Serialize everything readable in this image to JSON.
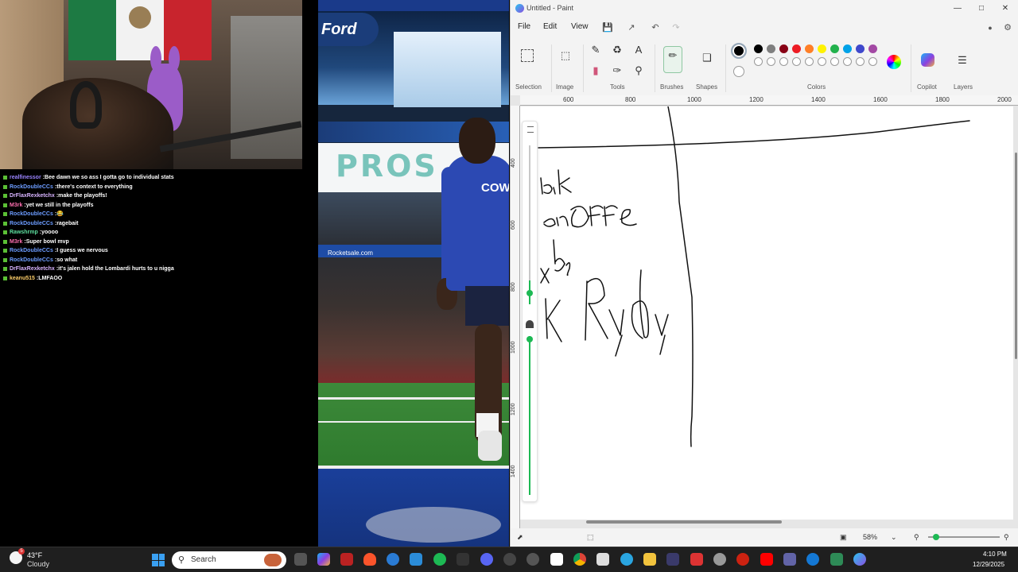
{
  "chat": {
    "messages": [
      {
        "user": "realfinessor",
        "user_color": "#9a84ff",
        "text": "Bee dawn we so ass I gotta go to individual stats"
      },
      {
        "user": "RockDoubleCCs",
        "user_color": "#6c9cff",
        "text": "there's context to everything"
      },
      {
        "user": "DrFlaxRexketchx",
        "user_color": "#d8b4ff",
        "text": "make the playoffs!"
      },
      {
        "user": "M3rk",
        "user_color": "#ff6fb0",
        "text": "yet we still in the playoffs"
      },
      {
        "user": "RockDoubleCCs",
        "user_color": "#6c9cff",
        "text": "😂"
      },
      {
        "user": "RockDoubleCCs",
        "user_color": "#6c9cff",
        "text": "ragebait"
      },
      {
        "user": "Rawshrmp",
        "user_color": "#5ee0a0",
        "text": "yoooo"
      },
      {
        "user": "M3rk",
        "user_color": "#ff6fb0",
        "text": "Super bowl mvp"
      },
      {
        "user": "RockDoubleCCs",
        "user_color": "#6c9cff",
        "text": "I guess we nervous"
      },
      {
        "user": "RockDoubleCCs",
        "user_color": "#6c9cff",
        "text": "so what"
      },
      {
        "user": "DrFlaxRexketchx",
        "user_color": "#d8b4ff",
        "text": "it's jalen hold the Lombardi hurts to u nigga"
      },
      {
        "user": "keanu515",
        "user_color": "#ffcf6a",
        "text": "LMFAOO"
      }
    ]
  },
  "photo": {
    "ford_text": "Ford",
    "pros_text": "PROS",
    "jersey_text": "COW",
    "bar_text": "Rocketsale.com"
  },
  "paint": {
    "title": "Untitled - Paint",
    "menu": {
      "file": "File",
      "edit": "Edit",
      "view": "View"
    },
    "groups": {
      "selection": "Selection",
      "image": "Image",
      "tools": "Tools",
      "brushes": "Brushes",
      "shapes": "Shapes",
      "colors": "Colors",
      "copilot": "Copilot",
      "layers": "Layers"
    },
    "palette_row1": [
      "#000000",
      "#7f7f7f",
      "#880015",
      "#ed1c24",
      "#ff7f27",
      "#fff200",
      "#22b14c",
      "#00a2e8",
      "#3f48cc",
      "#a349a4"
    ],
    "palette_row2": [
      "#ffffff",
      "#c3c3c3",
      "#b97a57",
      "#ffaec9",
      "#ffc90e",
      "#efe4b0",
      "#b5e61d",
      "#99d9ea",
      "#7092be",
      "#c8bfe7"
    ],
    "hruler_ticks": [
      "600",
      "800",
      "1000",
      "1200",
      "1400",
      "1600",
      "1800",
      "2000"
    ],
    "vruler_ticks": [
      "400",
      "600",
      "800",
      "1000",
      "1200",
      "1400"
    ],
    "zoom": "58%"
  },
  "taskbar": {
    "temp": "43°F",
    "condition": "Cloudy",
    "weather_badge": "5",
    "search_placeholder": "Search",
    "time": "4:10 PM",
    "date": "12/29/2025"
  }
}
